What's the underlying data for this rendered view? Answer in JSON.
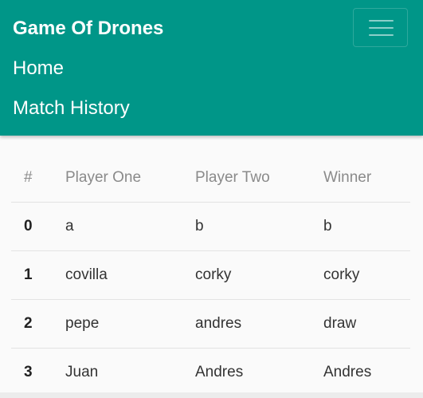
{
  "navbar": {
    "brand": "Game Of Drones",
    "toggler_icon": "hamburger-menu-icon",
    "links": [
      {
        "label": "Home"
      },
      {
        "label": "Match History"
      }
    ],
    "background_color": "#009688"
  },
  "history_table": {
    "headers": [
      "#",
      "Player One",
      "Player Two",
      "Winner"
    ],
    "rows": [
      {
        "index": "0",
        "player_one": "a",
        "player_two": "b",
        "winner": "b"
      },
      {
        "index": "1",
        "player_one": "covilla",
        "player_two": "corky",
        "winner": "corky"
      },
      {
        "index": "2",
        "player_one": "pepe",
        "player_two": "andres",
        "winner": "draw"
      },
      {
        "index": "3",
        "player_one": "Juan",
        "player_two": "Andres",
        "winner": "Andres"
      }
    ]
  }
}
